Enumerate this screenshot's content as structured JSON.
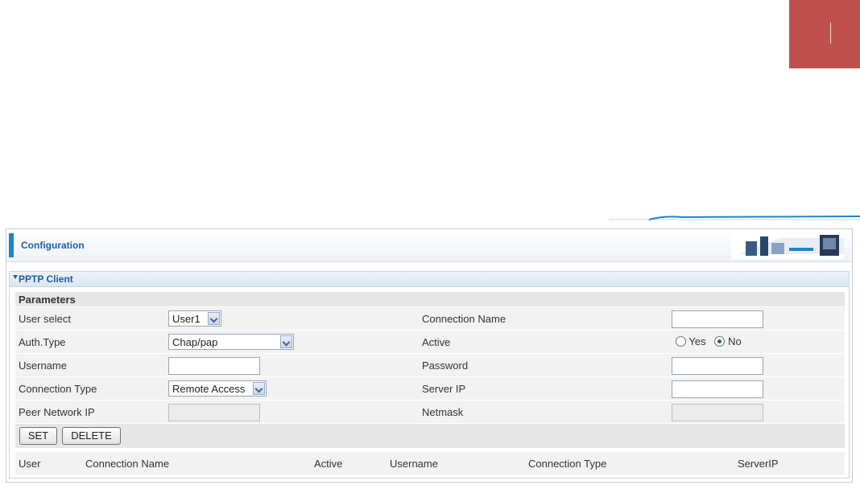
{
  "config": {
    "title": "Configuration"
  },
  "pptp": {
    "section_title": "PPTP Client"
  },
  "params": {
    "heading": "Parameters",
    "user_select": {
      "label": "User select",
      "value": "User1"
    },
    "connection_name": {
      "label": "Connection Name",
      "value": ""
    },
    "auth_type": {
      "label": "Auth.Type",
      "value": "Chap/pap"
    },
    "active": {
      "label": "Active",
      "options": [
        "Yes",
        "No"
      ],
      "selected": "No"
    },
    "username": {
      "label": "Username",
      "value": ""
    },
    "password": {
      "label": "Password",
      "value": ""
    },
    "connection_type": {
      "label": "Connection Type",
      "value": "Remote Access"
    },
    "server_ip": {
      "label": "Server IP",
      "value": ""
    },
    "peer_network_ip": {
      "label": "Peer Network IP",
      "value": ""
    },
    "netmask": {
      "label": "Netmask",
      "value": ""
    }
  },
  "buttons": {
    "set": "SET",
    "delete": "DELETE"
  },
  "table": {
    "columns": [
      "User",
      "Connection Name",
      "Active",
      "Username",
      "Connection Type",
      "ServerIP"
    ]
  },
  "colors": {
    "accent": "#1c86c9",
    "corner_tab": "#c0504d",
    "title_text": "#1a5ea7"
  }
}
